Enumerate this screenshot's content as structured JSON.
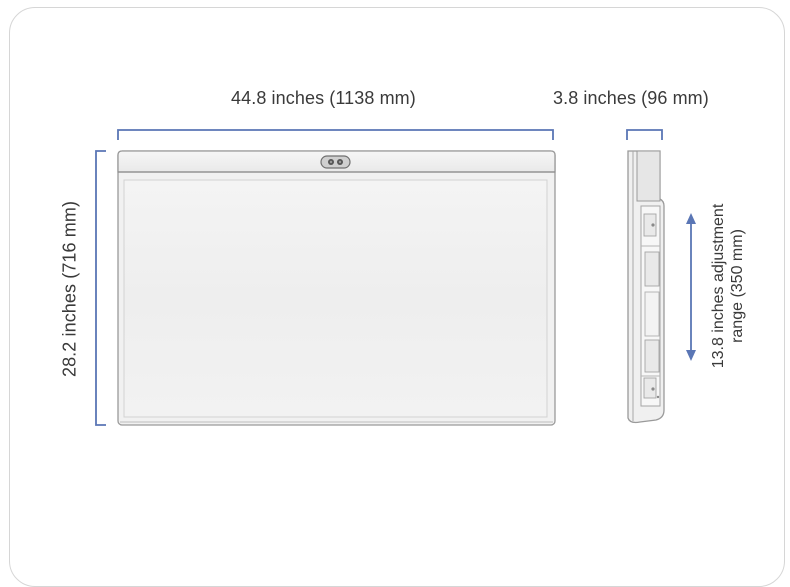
{
  "dimensions": {
    "width_label": "44.8 inches (1138 mm)",
    "depth_label": "3.8 inches (96 mm)",
    "height_label": "28.2 inches (716 mm)",
    "adjustment_label_line1": "13.8 inches adjustment",
    "adjustment_label_line2": "range (350 mm)"
  },
  "colors": {
    "bracket": "#5a76b5",
    "device_outline": "#9a9a9a",
    "device_fill": "#f1f1f1",
    "text": "#3a3a3a"
  },
  "icons": {
    "camera": "camera-icon",
    "arrow": "double-arrow-icon"
  }
}
